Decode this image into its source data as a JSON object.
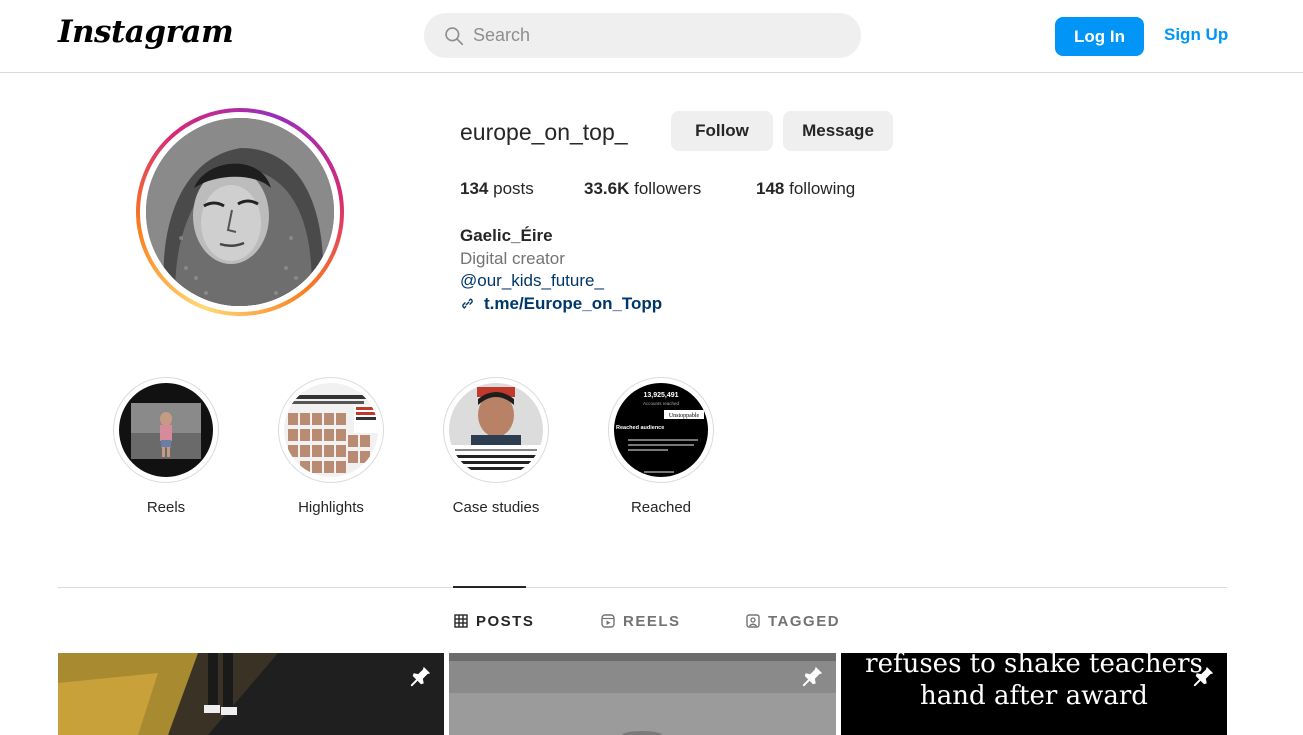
{
  "header": {
    "logo_text": "Instagram",
    "search_placeholder": "Search",
    "login_label": "Log In",
    "signup_label": "Sign Up"
  },
  "profile": {
    "username": "europe_on_top_",
    "follow_label": "Follow",
    "message_label": "Message",
    "stats": {
      "posts_count": "134",
      "posts_label": "posts",
      "followers_count": "33.6K",
      "followers_label": "followers",
      "following_count": "148",
      "following_label": "following"
    },
    "full_name": "Gaelic_Éire",
    "category": "Digital creator",
    "mention": "@our_kids_future_",
    "link": "t.me/Europe_on_Topp"
  },
  "highlights": [
    {
      "label": "Reels",
      "icon": "reel-thumbnail"
    },
    {
      "label": "Highlights",
      "icon": "collage-thumbnail"
    },
    {
      "label": "Case studies",
      "icon": "mugshot-thumbnail"
    },
    {
      "label": "Reached",
      "icon": "stats-thumbnail",
      "thumb_number": "13,925,491",
      "thumb_sub": "Accounts reached",
      "thumb_tag": "Unstoppable",
      "thumb_heading": "Reached audience"
    }
  ],
  "tabs": [
    {
      "label": "POSTS",
      "icon": "grid-icon",
      "active": true
    },
    {
      "label": "REELS",
      "icon": "reels-icon",
      "active": false
    },
    {
      "label": "TAGGED",
      "icon": "tagged-icon",
      "active": false
    }
  ],
  "posts": [
    {
      "pinned": true,
      "caption": ""
    },
    {
      "pinned": true,
      "caption": ""
    },
    {
      "pinned": true,
      "caption_line1": "refuses to shake teachers",
      "caption_line2": "hand after award"
    }
  ],
  "colors": {
    "accent": "#0095f6",
    "link": "#00376b",
    "secondary_text": "#737373",
    "button_bg": "#efefef",
    "border": "#dbdbdb"
  }
}
